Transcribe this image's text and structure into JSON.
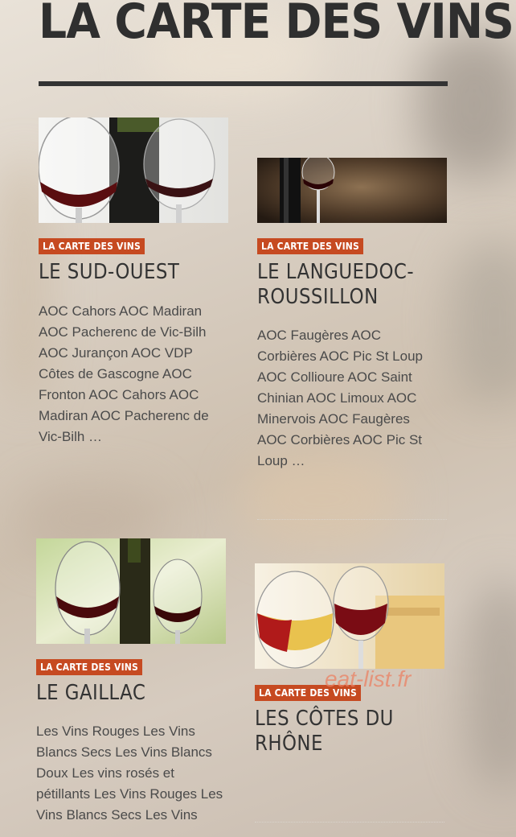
{
  "header": {
    "title": "LA CARTE DES VINS"
  },
  "cards": [
    {
      "category": "LA CARTE DES VINS",
      "title_lines": [
        "LE SUD-OUEST"
      ],
      "excerpt": "AOC Cahors AOC Madiran AOC Pacherenc de Vic-Bilh AOC Jurançon AOC VDP Côtes de Gascogne AOC Fronton AOC Cahors AOC Madiran AOC Pacherenc de Vic-Bilh …"
    },
    {
      "category": "LA CARTE DES VINS",
      "title_lines": [
        "LE LANGUEDOC-",
        "ROUSSILLON"
      ],
      "excerpt": "AOC Faugères AOC Corbières AOC Pic St Loup AOC Collioure AOC Saint Chinian AOC Limoux AOC Minervois AOC Faugères AOC Corbières AOC Pic St Loup …"
    },
    {
      "category": "LA CARTE DES VINS",
      "title_lines": [
        "LE GAILLAC"
      ],
      "excerpt": "Les Vins Rouges Les Vins Blancs Secs Les Vins Blancs Doux Les vins rosés et pétillants Les Vins Rouges Les Vins Blancs Secs Les Vins"
    },
    {
      "category": "LA CARTE DES VINS",
      "title_lines": [
        "LES CÔTES DU",
        "RHÔNE"
      ],
      "excerpt": ""
    }
  ],
  "watermark": "eat-list.fr"
}
